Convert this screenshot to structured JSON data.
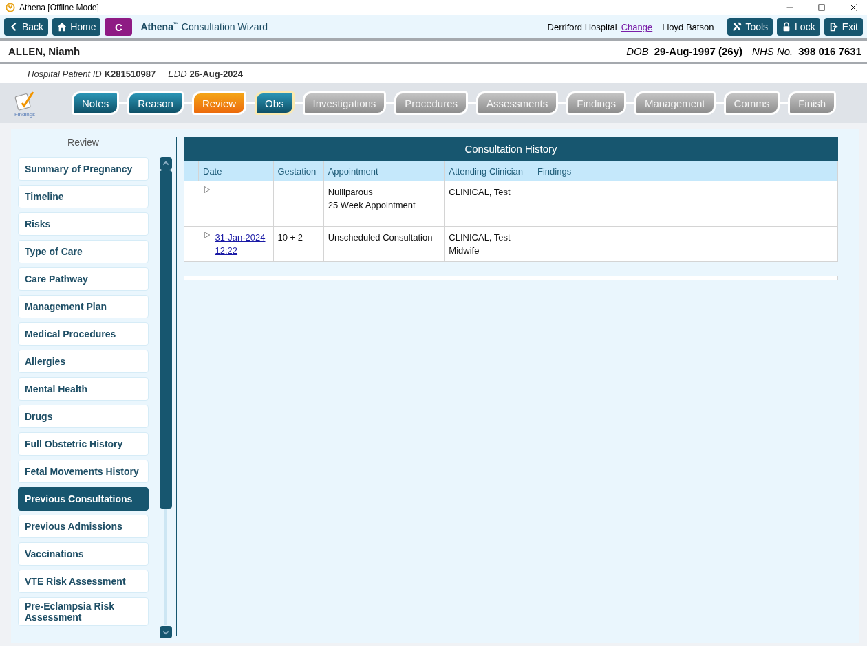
{
  "window": {
    "title": "Athena [Offline Mode]"
  },
  "toolbar": {
    "buttons": [
      {
        "kind": "back",
        "label": "Back"
      },
      {
        "kind": "home",
        "label": "Home"
      },
      {
        "kind": "letter",
        "label": "C"
      }
    ],
    "brand": "Athena",
    "brand_mark": "™",
    "title": "Consultation Wizard",
    "location": "Derriford Hospital",
    "change_link": "Change",
    "user": "Lloyd Batson",
    "actions": [
      {
        "kind": "tools",
        "label": "Tools"
      },
      {
        "kind": "lock",
        "label": "Lock"
      },
      {
        "kind": "exit",
        "label": "Exit"
      }
    ]
  },
  "patient": {
    "name": "ALLEN, Niamh",
    "dob_label": "DOB",
    "dob": "29-Aug-1997 (26y)",
    "nhs_label": "NHS No.",
    "nhs": "398 016 7631",
    "id_label": "Hospital Patient ID",
    "id": "K281510987",
    "edd_label": "EDD",
    "edd": "26-Aug-2024"
  },
  "findings_shortcut": {
    "label": "Findings"
  },
  "steps": [
    {
      "label": "Notes",
      "selected": false,
      "completed": true,
      "flagged": false
    },
    {
      "label": "Reason",
      "selected": false,
      "completed": true,
      "flagged": false
    },
    {
      "label": "Review",
      "selected": true,
      "completed": false,
      "flagged": false
    },
    {
      "label": "Obs",
      "selected": false,
      "completed": true,
      "flagged": true
    },
    {
      "label": "Investigations",
      "selected": false,
      "completed": false,
      "flagged": false
    },
    {
      "label": "Procedures",
      "selected": false,
      "completed": false,
      "flagged": false
    },
    {
      "label": "Assessments",
      "selected": false,
      "completed": false,
      "flagged": false
    },
    {
      "label": "Findings",
      "selected": false,
      "completed": false,
      "flagged": false
    },
    {
      "label": "Management",
      "selected": false,
      "completed": false,
      "flagged": false
    },
    {
      "label": "Comms",
      "selected": false,
      "completed": false,
      "flagged": false
    },
    {
      "label": "Finish",
      "selected": false,
      "completed": false,
      "flagged": false
    }
  ],
  "sidebar": {
    "title": "Review",
    "items": [
      {
        "label": "Summary of Pregnancy",
        "selected": false
      },
      {
        "label": "Timeline",
        "selected": false
      },
      {
        "label": "Risks",
        "selected": false
      },
      {
        "label": "Type of Care",
        "selected": false
      },
      {
        "label": "Care Pathway",
        "selected": false
      },
      {
        "label": "Management Plan",
        "selected": false
      },
      {
        "label": "Medical Procedures",
        "selected": false
      },
      {
        "label": "Allergies",
        "selected": false
      },
      {
        "label": "Mental Health",
        "selected": false
      },
      {
        "label": "Drugs",
        "selected": false
      },
      {
        "label": "Full Obstetric History",
        "selected": false
      },
      {
        "label": "Fetal Movements History",
        "selected": false
      },
      {
        "label": "Previous Consultations",
        "selected": true
      },
      {
        "label": "Previous Admissions",
        "selected": false
      },
      {
        "label": "Vaccinations",
        "selected": false
      },
      {
        "label": "VTE Risk Assessment",
        "selected": false
      },
      {
        "label": "Pre-Eclampsia Risk Assessment",
        "selected": false
      }
    ]
  },
  "table": {
    "title": "Consultation History",
    "columns": [
      "Date",
      "Gestation",
      "Appointment",
      "Attending Clinician",
      "Findings"
    ],
    "rows": [
      {
        "date": [],
        "gestation": "",
        "appointment": [
          "Nulliparous",
          "25 Week Appointment"
        ],
        "clinician": [
          "CLINICAL, Test"
        ],
        "findings": ""
      },
      {
        "date": [
          "31-Jan-2024",
          "12:22"
        ],
        "gestation": "10 + 2",
        "appointment": [
          "Unscheduled Consultation"
        ],
        "clinician": [
          "CLINICAL, Test",
          "Midwife"
        ],
        "findings": ""
      }
    ]
  }
}
